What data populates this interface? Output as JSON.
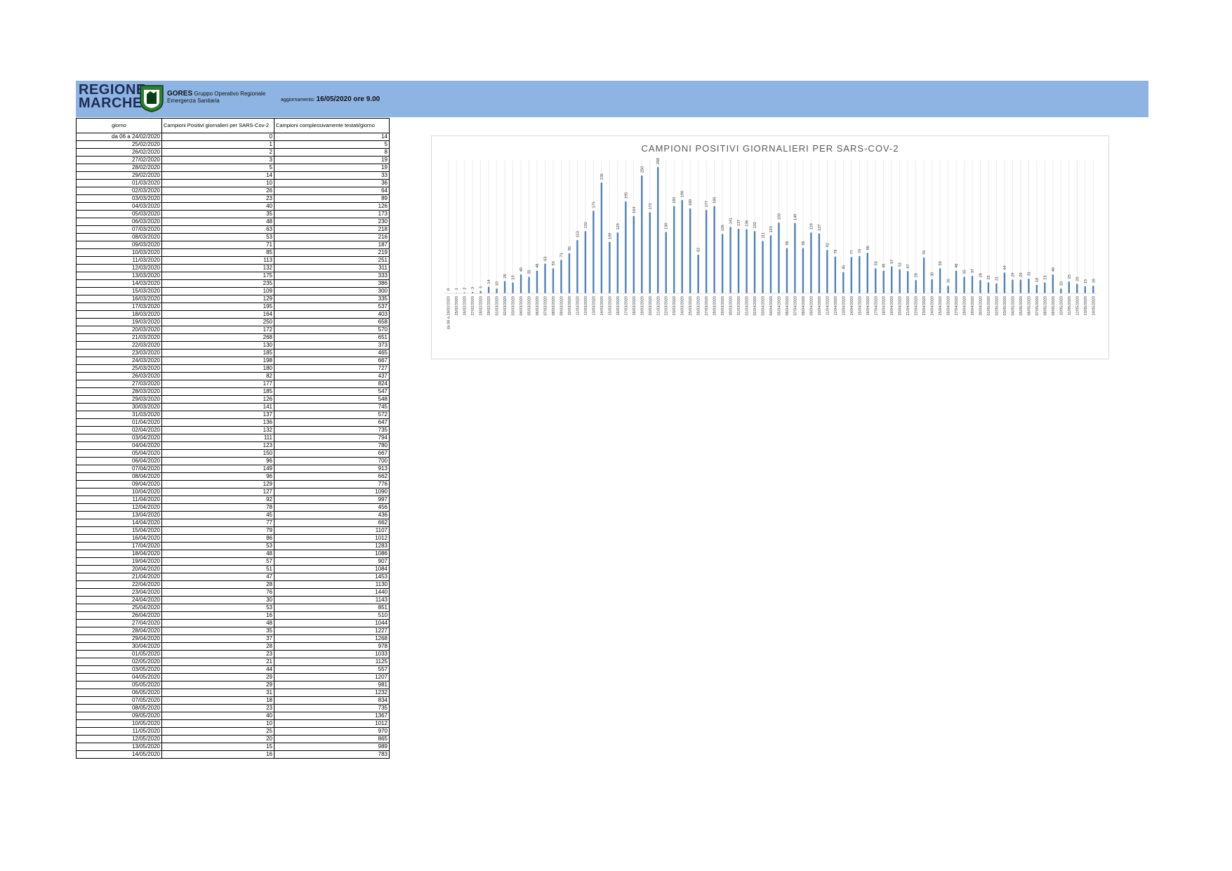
{
  "header": {
    "logo_line1": "REGIONE",
    "logo_line2": "MARCHE",
    "org_acronym": "GORES",
    "org_line1": "Gruppo Operativo Regionale",
    "org_line2": "Emergenza Sanitaria",
    "update_label": "aggiornamento:",
    "update_value": "16/05/2020 ore 9.00",
    "banner_color": "#8db4e2"
  },
  "table": {
    "headers": [
      "giorno",
      "Campioni Positivi giornalieri per SARS-Cov-2",
      "Campioni complessivamente testati/giorno"
    ],
    "rows": [
      [
        "da 06 a 24/02/2020",
        "0",
        "14"
      ],
      [
        "25/02/2020",
        "1",
        "5"
      ],
      [
        "26/02/2020",
        "2",
        "8"
      ],
      [
        "27/02/2020",
        "3",
        "19"
      ],
      [
        "28/02/2020",
        "5",
        "19"
      ],
      [
        "29/02/2020",
        "14",
        "33"
      ],
      [
        "01/03/2020",
        "10",
        "36"
      ],
      [
        "02/03/2020",
        "26",
        "64"
      ],
      [
        "03/03/2020",
        "23",
        "89"
      ],
      [
        "04/03/2020",
        "40",
        "126"
      ],
      [
        "05/03/2020",
        "35",
        "173"
      ],
      [
        "06/03/2020",
        "48",
        "230"
      ],
      [
        "07/03/2020",
        "63",
        "218"
      ],
      [
        "08/03/2020",
        "53",
        "216"
      ],
      [
        "09/03/2020",
        "71",
        "187"
      ],
      [
        "10/03/2020",
        "85",
        "219"
      ],
      [
        "11/03/2020",
        "113",
        "251"
      ],
      [
        "12/03/2020",
        "132",
        "311"
      ],
      [
        "13/03/2020",
        "175",
        "333"
      ],
      [
        "14/03/2020",
        "235",
        "386"
      ],
      [
        "15/03/2020",
        "109",
        "300"
      ],
      [
        "16/03/2020",
        "129",
        "335"
      ],
      [
        "17/03/2020",
        "195",
        "537"
      ],
      [
        "18/03/2020",
        "164",
        "403"
      ],
      [
        "19/03/2020",
        "250",
        "658"
      ],
      [
        "20/03/2020",
        "172",
        "570"
      ],
      [
        "21/03/2020",
        "268",
        "651"
      ],
      [
        "22/03/2020",
        "130",
        "373"
      ],
      [
        "23/03/2020",
        "185",
        "465"
      ],
      [
        "24/03/2020",
        "198",
        "667"
      ],
      [
        "25/03/2020",
        "180",
        "727"
      ],
      [
        "26/03/2020",
        "82",
        "437"
      ],
      [
        "27/03/2020",
        "177",
        "824"
      ],
      [
        "28/03/2020",
        "185",
        "547"
      ],
      [
        "29/03/2020",
        "126",
        "548"
      ],
      [
        "30/03/2020",
        "141",
        "745"
      ],
      [
        "31/03/2020",
        "137",
        "572"
      ],
      [
        "01/04/2020",
        "136",
        "647"
      ],
      [
        "02/04/2020",
        "132",
        "735"
      ],
      [
        "03/04/2020",
        "111",
        "794"
      ],
      [
        "04/04/2020",
        "123",
        "780"
      ],
      [
        "05/04/2020",
        "150",
        "667"
      ],
      [
        "06/04/2020",
        "96",
        "700"
      ],
      [
        "07/04/2020",
        "149",
        "913"
      ],
      [
        "08/04/2020",
        "96",
        "662"
      ],
      [
        "09/04/2020",
        "129",
        "776"
      ],
      [
        "10/04/2020",
        "127",
        "1090"
      ],
      [
        "11/04/2020",
        "92",
        "997"
      ],
      [
        "12/04/2020",
        "78",
        "456"
      ],
      [
        "13/04/2020",
        "45",
        "436"
      ],
      [
        "14/04/2020",
        "77",
        "662"
      ],
      [
        "15/04/2020",
        "79",
        "1107"
      ],
      [
        "16/04/2020",
        "86",
        "1012"
      ],
      [
        "17/04/2020",
        "53",
        "1283"
      ],
      [
        "18/04/2020",
        "48",
        "1086"
      ],
      [
        "19/04/2020",
        "57",
        "907"
      ],
      [
        "20/04/2020",
        "51",
        "1084"
      ],
      [
        "21/04/2020",
        "47",
        "1453"
      ],
      [
        "22/04/2020",
        "28",
        "1130"
      ],
      [
        "23/04/2020",
        "76",
        "1440"
      ],
      [
        "24/04/2020",
        "30",
        "1143"
      ],
      [
        "25/04/2020",
        "53",
        "851"
      ],
      [
        "26/04/2020",
        "16",
        "510"
      ],
      [
        "27/04/2020",
        "48",
        "1044"
      ],
      [
        "28/04/2020",
        "35",
        "1227"
      ],
      [
        "29/04/2020",
        "37",
        "1268"
      ],
      [
        "30/04/2020",
        "28",
        "978"
      ],
      [
        "01/05/2020",
        "23",
        "1033"
      ],
      [
        "02/05/2020",
        "21",
        "1125"
      ],
      [
        "03/05/2020",
        "44",
        "557"
      ],
      [
        "04/05/2020",
        "29",
        "1207"
      ],
      [
        "05/05/2020",
        "29",
        "981"
      ],
      [
        "06/05/2020",
        "31",
        "1232"
      ],
      [
        "07/05/2020",
        "18",
        "834"
      ],
      [
        "08/05/2020",
        "23",
        "735"
      ],
      [
        "09/05/2020",
        "40",
        "1367"
      ],
      [
        "10/05/2020",
        "10",
        "1012"
      ],
      [
        "11/05/2020",
        "25",
        "970"
      ],
      [
        "12/05/2020",
        "20",
        "865"
      ],
      [
        "13/05/2020",
        "15",
        "989"
      ],
      [
        "14/05/2020",
        "16",
        "783"
      ]
    ]
  },
  "chart_data": {
    "type": "bar",
    "title": "CAMPIONI POSITIVI GIORNALIERI PER SARS-COV-2",
    "bar_color": "#4f81bd",
    "grid": true,
    "categories": [
      "da 06 a 24/02/2020",
      "25/02/2020",
      "26/02/2020",
      "27/02/2020",
      "28/02/2020",
      "29/02/2020",
      "01/03/2020",
      "02/03/2020",
      "03/03/2020",
      "04/03/2020",
      "05/03/2020",
      "06/03/2020",
      "07/03/2020",
      "08/03/2020",
      "09/03/2020",
      "10/03/2020",
      "11/03/2020",
      "12/03/2020",
      "13/03/2020",
      "14/03/2020",
      "15/03/2020",
      "16/03/2020",
      "17/03/2020",
      "18/03/2020",
      "19/03/2020",
      "20/03/2020",
      "21/03/2020",
      "22/03/2020",
      "23/03/2020",
      "24/03/2020",
      "25/03/2020",
      "26/03/2020",
      "27/03/2020",
      "28/03/2020",
      "29/03/2020",
      "30/03/2020",
      "31/03/2020",
      "01/04/2020",
      "02/04/2020",
      "03/04/2020",
      "04/04/2020",
      "05/04/2020",
      "06/04/2020",
      "07/04/2020",
      "08/04/2020",
      "09/04/2020",
      "10/04/2020",
      "11/04/2020",
      "12/04/2020",
      "13/04/2020",
      "14/04/2020",
      "15/04/2020",
      "16/04/2020",
      "17/04/2020",
      "18/04/2020",
      "19/04/2020",
      "20/04/2020",
      "21/04/2020",
      "22/04/2020",
      "23/04/2020",
      "24/04/2020",
      "25/04/2020",
      "26/04/2020",
      "27/04/2020",
      "28/04/2020",
      "29/04/2020",
      "30/04/2020",
      "01/05/2020",
      "02/05/2020",
      "03/05/2020",
      "04/05/2020",
      "05/05/2020",
      "06/05/2020",
      "07/05/2020",
      "08/05/2020",
      "09/05/2020",
      "10/05/2020",
      "11/05/2020",
      "12/05/2020",
      "13/05/2020",
      "14/05/2020"
    ],
    "values": [
      0,
      1,
      2,
      3,
      5,
      14,
      10,
      26,
      23,
      40,
      35,
      48,
      63,
      53,
      71,
      85,
      113,
      132,
      175,
      235,
      109,
      129,
      195,
      164,
      250,
      172,
      268,
      130,
      185,
      198,
      180,
      82,
      177,
      185,
      126,
      141,
      137,
      136,
      132,
      111,
      123,
      150,
      96,
      149,
      96,
      129,
      127,
      92,
      78,
      45,
      77,
      79,
      86,
      53,
      48,
      57,
      51,
      47,
      28,
      76,
      30,
      53,
      16,
      48,
      35,
      37,
      28,
      23,
      21,
      44,
      29,
      29,
      31,
      18,
      23,
      40,
      10,
      25,
      20,
      15,
      16
    ],
    "ylim": [
      0,
      280
    ]
  }
}
